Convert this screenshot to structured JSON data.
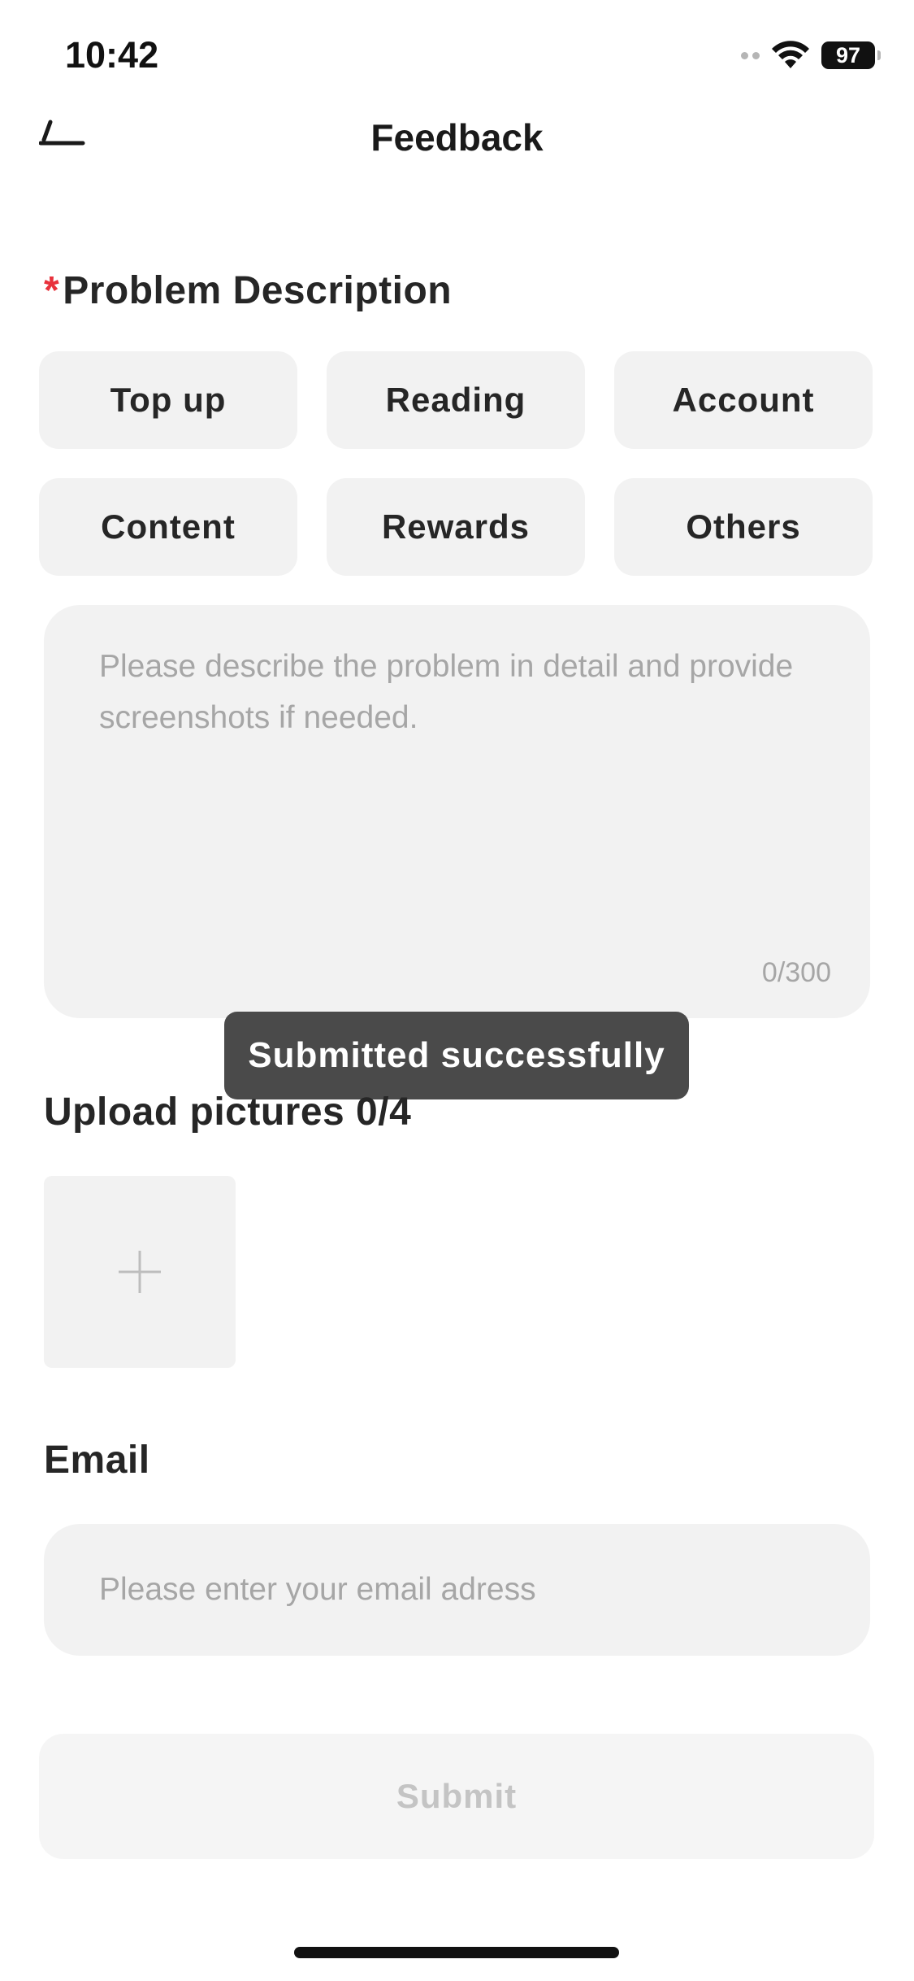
{
  "status_bar": {
    "time": "10:42",
    "battery": "97"
  },
  "nav": {
    "title": "Feedback"
  },
  "problem": {
    "required_mark": "*",
    "title": "Problem Description",
    "categories": [
      "Top up",
      "Reading",
      "Account",
      "Content",
      "Rewards",
      "Others"
    ],
    "textarea_placeholder": "Please describe the problem in detail and provide screenshots if needed.",
    "counter": "0/300"
  },
  "toast": {
    "message": "Submitted successfully"
  },
  "upload": {
    "title": "Upload pictures 0/4"
  },
  "email": {
    "title": "Email",
    "placeholder": "Please enter your email adress",
    "value": ""
  },
  "submit": {
    "label": "Submit"
  },
  "colors": {
    "required": "#e8323c",
    "chip_bg": "#f2f2f2",
    "toast_bg": "#4a4a4a",
    "placeholder": "#a6a6a6"
  }
}
